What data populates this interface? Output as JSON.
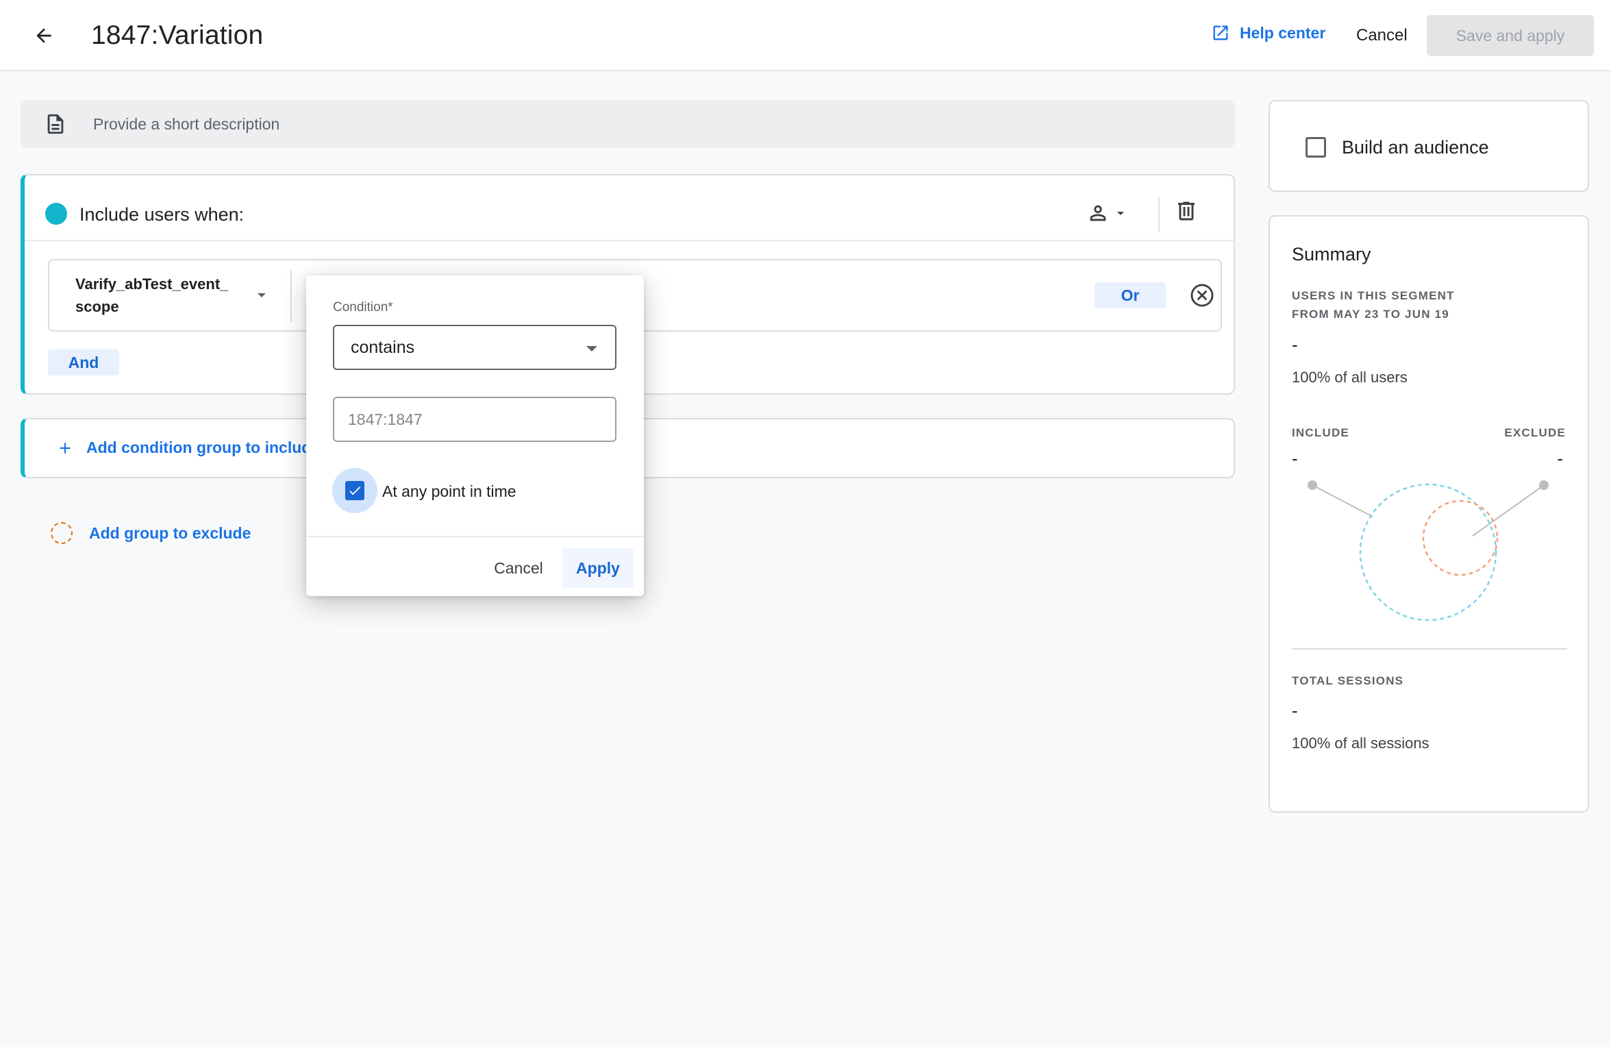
{
  "header": {
    "title": "1847:Variation",
    "help_label": "Help center",
    "cancel_label": "Cancel",
    "save_label": "Save and apply"
  },
  "description": {
    "placeholder": "Provide a short description"
  },
  "include_group": {
    "title": "Include users when:",
    "dimension_line1": "Varify_abTest_event_",
    "dimension_line2": "scope",
    "or_label": "Or",
    "and_label": "And"
  },
  "add_condition_group_label": "Add condition group to includ",
  "add_exclude_label": "Add group to exclude",
  "popup": {
    "condition_label": "Condition*",
    "condition_value": "contains",
    "value_placeholder": "1847:1847",
    "checkbox_label": "At any point in time",
    "checkbox_checked": true,
    "cancel_label": "Cancel",
    "apply_label": "Apply"
  },
  "audience": {
    "label": "Build an audience",
    "checked": false
  },
  "summary": {
    "title": "Summary",
    "users_label_line1": "USERS IN THIS SEGMENT",
    "users_label_line2": "FROM MAY 23 TO JUN 19",
    "users_value": "-",
    "users_pct": "100% of all users",
    "include_label": "INCLUDE",
    "include_value": "-",
    "exclude_label": "EXCLUDE",
    "exclude_value": "-",
    "sessions_label": "TOTAL SESSIONS",
    "sessions_value": "-",
    "sessions_pct": "100% of all sessions"
  },
  "colors": {
    "accent": "#1a73e8",
    "include": "#12b5cb",
    "exclude": "#e8710a"
  }
}
